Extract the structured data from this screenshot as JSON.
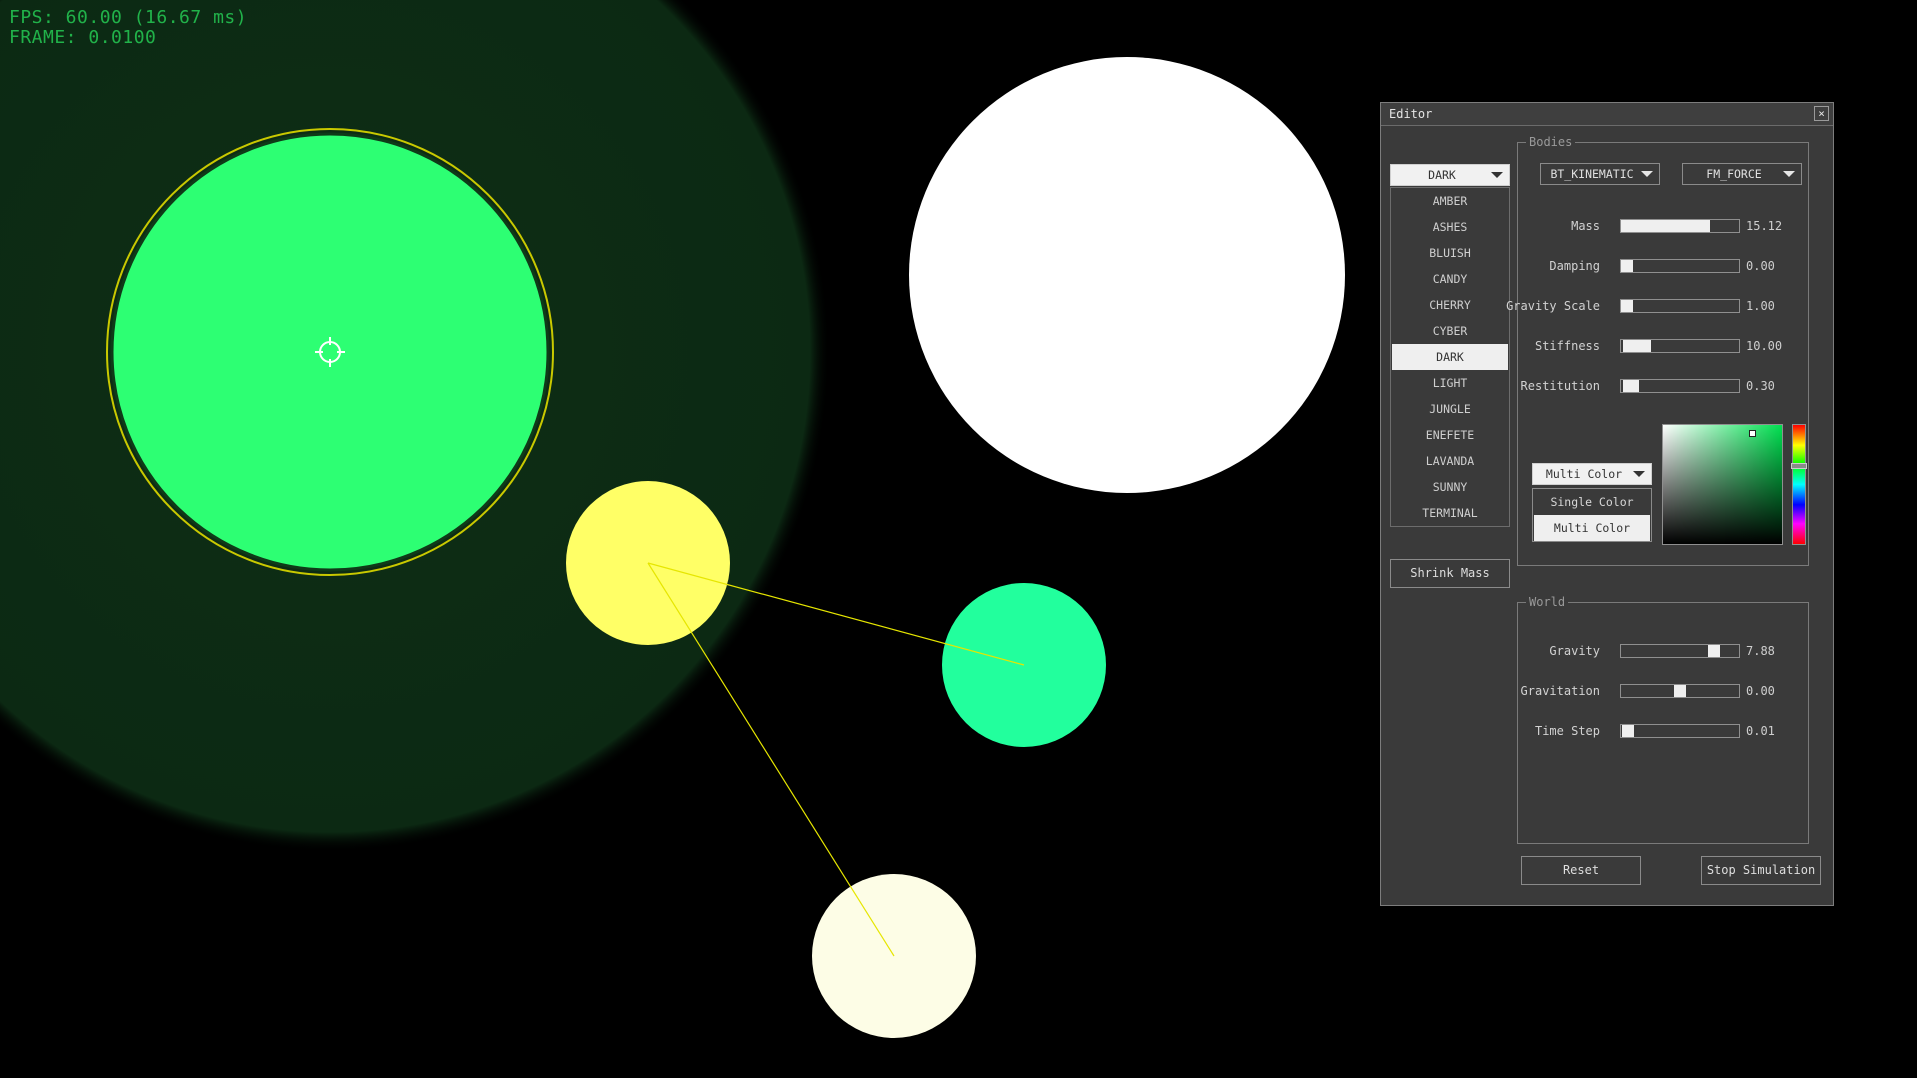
{
  "hud": {
    "fps": "FPS: 60.00 (16.67 ms)",
    "frame": "FRAME: 0.0100"
  },
  "editor": {
    "title": "Editor",
    "close_icon": "×",
    "bodies": {
      "group_label": "Bodies",
      "theme_selected": "DARK",
      "themes": [
        "AMBER",
        "ASHES",
        "BLUISH",
        "CANDY",
        "CHERRY",
        "CYBER",
        "DARK",
        "LIGHT",
        "JUNGLE",
        "ENEFETE",
        "LAVANDA",
        "SUNNY",
        "TERMINAL"
      ],
      "body_type": "BT_KINEMATIC",
      "force_mode": "FM_FORCE",
      "sliders": [
        {
          "label": "Mass",
          "value": "15.12",
          "fraction": 0.75
        },
        {
          "label": "Damping",
          "value": "0.00",
          "fraction": 0.0
        },
        {
          "label": "Gravity Scale",
          "value": "1.00",
          "fraction": 0.0
        },
        {
          "label": "Stiffness",
          "value": "10.00",
          "fraction": 0.2
        },
        {
          "label": "Restitution",
          "value": "0.30",
          "fraction": 0.1
        }
      ],
      "color_mode_selected": "Multi Color",
      "color_modes": [
        "Single Color",
        "Multi Color"
      ],
      "color": "#00d64b"
    },
    "world": {
      "group_label": "World",
      "sliders": [
        {
          "label": "Gravity",
          "value": "7.88",
          "fraction": 0.82
        },
        {
          "label": "Gravitation",
          "value": "0.00",
          "fraction": 0.5
        },
        {
          "label": "Time Step",
          "value": "0.01",
          "fraction": 0.01
        }
      ]
    },
    "buttons": {
      "shrink_mass": "Shrink Mass",
      "reset": "Reset",
      "stop": "Stop Simulation"
    }
  },
  "colors": {
    "hud_text": "#21b24a",
    "body_green": "#2dff73",
    "body_white": "#ffffff",
    "body_yellow": "#ffff66",
    "body_teal": "#22ff9d",
    "body_cream": "#fdfde6",
    "spring_line": "#e6e600",
    "gravity_field": "#0d2a14"
  }
}
